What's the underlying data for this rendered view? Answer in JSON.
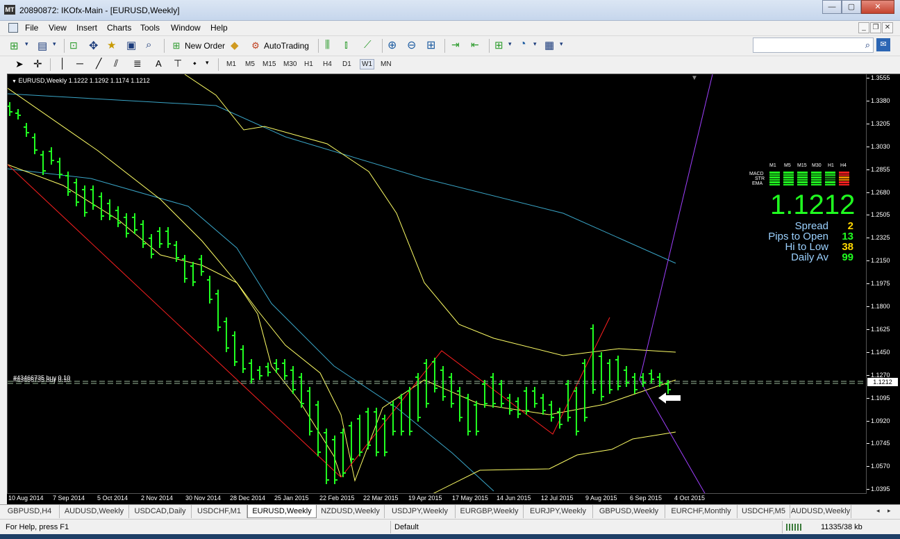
{
  "window": {
    "title": "20890872: IKOfx-Main - [EURUSD,Weekly]",
    "controls": {
      "minimize": "—",
      "maximize": "▢",
      "close": "✕"
    }
  },
  "menu": {
    "items": [
      "File",
      "View",
      "Insert",
      "Charts",
      "Tools",
      "Window",
      "Help"
    ],
    "mdi": {
      "minimize": "_",
      "restore": "❐",
      "close": "✕"
    }
  },
  "toolbar": {
    "new_order": "New Order",
    "autotrading": "AutoTrading",
    "search_placeholder": "",
    "search_icon": "search-icon",
    "draw_text_tool": "A",
    "timeframes": [
      "M1",
      "M5",
      "M15",
      "M30",
      "H1",
      "H4",
      "D1",
      "W1",
      "MN"
    ],
    "active_timeframe": "W1"
  },
  "chart": {
    "header": "EURUSD,Weekly  1.1222 1.1292 1.1174 1.1212",
    "current_price": "1.1212",
    "order_label": "#43466735 buy 0.10",
    "price_ticks": [
      "1.3555",
      "1.3380",
      "1.3205",
      "1.3030",
      "1.2855",
      "1.2680",
      "1.2505",
      "1.2325",
      "1.2150",
      "1.1975",
      "1.1800",
      "1.1625",
      "1.1450",
      "1.1270",
      "1.1095",
      "1.0920",
      "1.0745",
      "1.0570",
      "1.0395"
    ],
    "time_ticks": [
      "10 Aug 2014",
      "7 Sep 2014",
      "5 Oct 2014",
      "2 Nov 2014",
      "30 Nov 2014",
      "28 Dec 2014",
      "25 Jan 2015",
      "22 Feb 2015",
      "22 Mar 2015",
      "19 Apr 2015",
      "17 May 2015",
      "14 Jun 2015",
      "12 Jul 2015",
      "9 Aug 2015",
      "6 Sep 2015",
      "4 Oct 2015"
    ],
    "colors": {
      "bars": "#20ff20",
      "yellow_band": "#ffff66",
      "teal_ma": "#3aa6c8",
      "red_trend": "#ff2020",
      "purple_trend": "#a040ff",
      "gray_ma": "#9a9a9a"
    }
  },
  "indicator_panel": {
    "timeframes": [
      "M1",
      "M5",
      "M15",
      "M30",
      "H1",
      "H4"
    ],
    "rows": [
      {
        "label": "MACD",
        "colors": [
          "#20ff20",
          "#20ff20",
          "#20ff20",
          "#20ff20",
          "#20ff20",
          "#ff2020"
        ]
      },
      {
        "label": "STR",
        "colors": [
          "#20ff20",
          "#20ff20",
          "#20ff20",
          "#20ff20",
          "#1a8a1a",
          "#ff8c00"
        ]
      },
      {
        "label": "EMA",
        "colors": [
          "#20ff20",
          "#20ff20",
          "#20ff20",
          "#20ff20",
          "#20ff20",
          "#ff2020"
        ]
      }
    ],
    "price": "1.1212",
    "stats": [
      {
        "label": "Spread",
        "value": "2",
        "color": "#ffd700"
      },
      {
        "label": "Pips to Open",
        "value": "13",
        "color": "#20ff20"
      },
      {
        "label": "Hi to Low",
        "value": "38",
        "color": "#ffd700"
      },
      {
        "label": "Daily Av",
        "value": "99",
        "color": "#20ff20"
      }
    ]
  },
  "tabs": {
    "items": [
      "GBPUSD,H4",
      "AUDUSD,Weekly",
      "USDCAD,Daily",
      "USDCHF,M1",
      "EURUSD,Weekly",
      "NZDUSD,Weekly",
      "USDJPY,Weekly",
      "EURGBP,Weekly",
      "EURJPY,Weekly",
      "GBPUSD,Weekly",
      "EURCHF,Monthly",
      "USDCHF,M5",
      "AUDUSD,Weekly"
    ],
    "active_index": 4,
    "nav_left": "◂",
    "nav_right": "▸"
  },
  "status": {
    "help": "For Help, press F1",
    "profile": "Default",
    "traffic": "11335/38 kb"
  }
}
